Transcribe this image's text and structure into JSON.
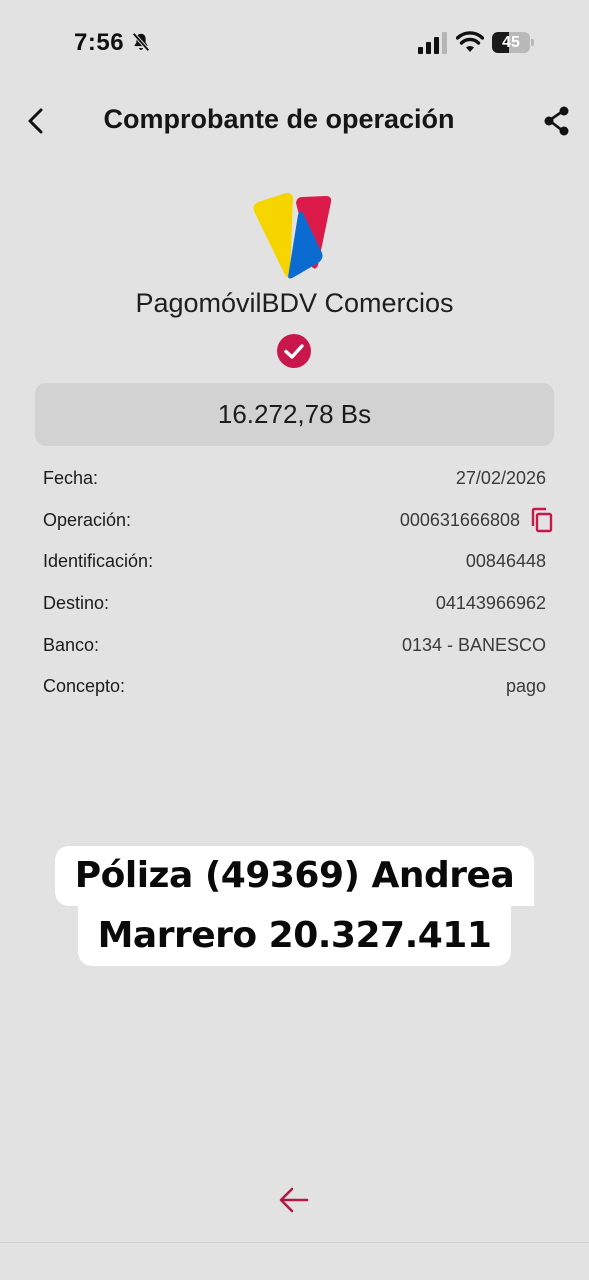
{
  "status_bar": {
    "time": "7:56",
    "battery_level": "45",
    "battery_fraction": 0.45,
    "icons": [
      "bell-muted-icon",
      "cellular-signal-icon",
      "wifi-icon",
      "battery-icon"
    ]
  },
  "header": {
    "title": "Comprobante de operación",
    "back_icon": "chevron-left-icon",
    "share_icon": "share-icon"
  },
  "brand": {
    "name": "PagomóvilBDV Comercios",
    "logo_colors": [
      "#f5d400",
      "#0c6bd1",
      "#dc1a4a"
    ],
    "check_color": "#c8174a"
  },
  "amount": "16.272,78 Bs",
  "details": [
    {
      "label": "Fecha:",
      "value": "27/02/2026"
    },
    {
      "label": "Operación:",
      "value": "000631666808",
      "copy_icon": "copy-icon"
    },
    {
      "label": "Identificación:",
      "value": "00846448"
    },
    {
      "label": "Destino:",
      "value": "04143966962"
    },
    {
      "label": "Banco:",
      "value": "0134 - BANESCO"
    },
    {
      "label": "Concepto:",
      "value": "pago"
    }
  ],
  "caption": {
    "line1": "Póliza (49369) Andrea",
    "line2": "Marrero 20.327.411"
  },
  "footer": {
    "back_icon": "arrow-left-icon",
    "accent_color": "#b01a44"
  }
}
